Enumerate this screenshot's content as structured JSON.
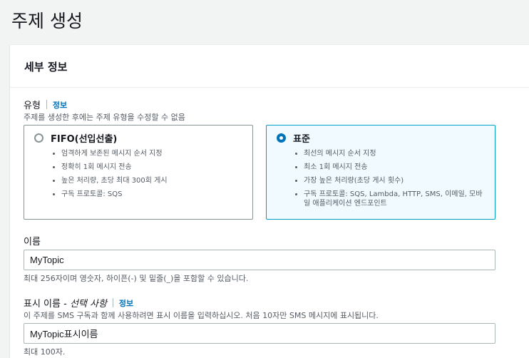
{
  "page": {
    "title": "주제 생성"
  },
  "panel": {
    "title": "세부 정보"
  },
  "type_field": {
    "label": "유형",
    "info": "정보",
    "description": "주제를 생성한 후에는 주제 유형을 수정할 수 없음",
    "options": [
      {
        "title": "FIFO(선입선출)",
        "selected": false,
        "bullets": [
          "엄격하게 보존된 메시지 순서 지정",
          "정확히 1회 메시지 전송",
          "높은 처리량, 초당 최대 300회 게시",
          "구독 프로토콜: SQS"
        ]
      },
      {
        "title": "표준",
        "selected": true,
        "bullets": [
          "최선의 메시지 순서 지정",
          "최소 1회 메시지 전송",
          "가장 높은 처리량(초당 게시 횟수)",
          "구독 프로토콜: SQS, Lambda, HTTP, SMS, 이메일, 모바일 애플리케이션 엔드포인트"
        ]
      }
    ]
  },
  "name_field": {
    "label": "이름",
    "value": "MyTopic",
    "constraint": "최대 256자이며 영숫자, 하이픈(-) 및 밑줄(_)을 포함할 수 있습니다."
  },
  "display_name_field": {
    "label": "표시 이름 - ",
    "label_optional": "선택 사항",
    "info": "정보",
    "description": "이 주제를 SMS 구독과 함께 사용하려면 표시 이름을 입력하십시오. 처음 10자만 SMS 메시지에 표시됩니다.",
    "value": "MyTopic표시이름",
    "constraint": "최대 100자."
  },
  "colors": {
    "accent": "#0073bb",
    "selected_border": "#00a1c9",
    "selected_bg": "#f1faff"
  }
}
